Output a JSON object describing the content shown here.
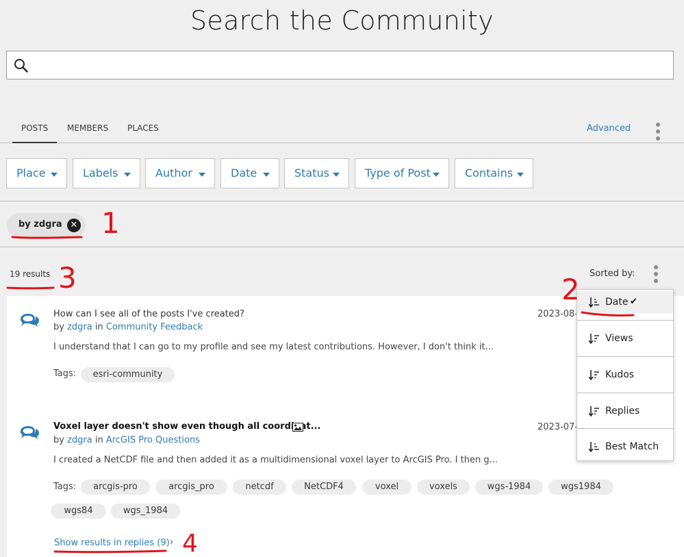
{
  "page": {
    "title": "Search the Community"
  },
  "search": {
    "value": "",
    "placeholder": ""
  },
  "tabs": [
    {
      "label": "POSTS",
      "active": true
    },
    {
      "label": "MEMBERS",
      "active": false
    },
    {
      "label": "PLACES",
      "active": false
    }
  ],
  "advanced_label": "Advanced",
  "filters": [
    "Place",
    "Labels",
    "Author",
    "Date",
    "Status",
    "Type of Post",
    "Contains"
  ],
  "active_filter_chip": {
    "label": "by zdgra"
  },
  "results_count": "19 results",
  "sort": {
    "label": "Sorted by:",
    "options": [
      {
        "label": "Date",
        "selected": true
      },
      {
        "label": "Views",
        "selected": false
      },
      {
        "label": "Kudos",
        "selected": false
      },
      {
        "label": "Replies",
        "selected": false
      },
      {
        "label": "Best Match",
        "selected": false
      }
    ]
  },
  "posts": [
    {
      "title": "How can I see all of the posts I've created?",
      "by": "by",
      "author": "zdgra",
      "in": "in",
      "board": "Community Feedback",
      "date": "2023-08-",
      "snippet": "I understand that I can go to my profile and see my latest contributions. However, I don't think it...",
      "tags_label": "Tags:",
      "tags": [
        "esri-community"
      ]
    },
    {
      "title": "Voxel layer doesn't show even though all coordinat...",
      "by": "by",
      "author": "zdgra",
      "in": "in",
      "board": "ArcGIS Pro Questions",
      "date": "2023-07-",
      "snippet": "I created a NetCDF file and then added it as a multidimensional voxel layer to ArcGIS Pro. I then g...",
      "tags_label": "Tags:",
      "tags": [
        "arcgis-pro",
        "arcgis_pro",
        "netcdf",
        "NetCDF4",
        "voxel",
        "voxels",
        "wgs-1984",
        "wgs1984",
        "wgs84",
        "wgs_1984"
      ],
      "show_replies": "Show results in replies (9)"
    }
  ],
  "annotations": {
    "n1": "1",
    "n2": "2",
    "n3": "3",
    "n4": "4"
  },
  "colors": {
    "link": "#2e7bb8",
    "annotation": "#e0141b",
    "background": "#efefef"
  }
}
